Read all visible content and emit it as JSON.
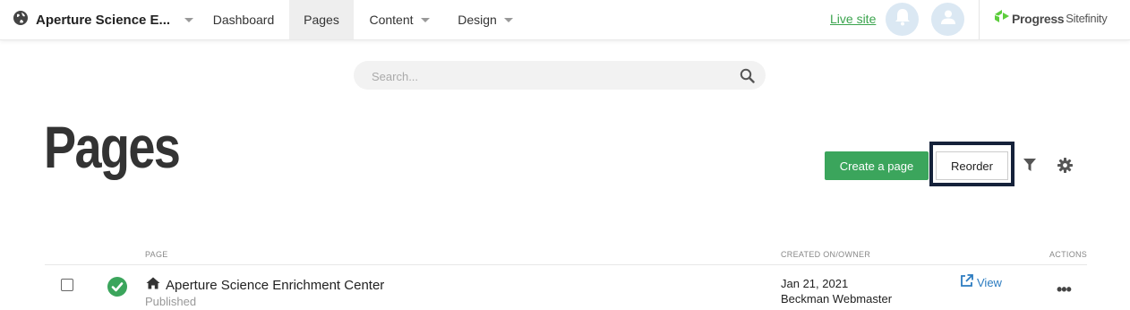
{
  "nav": {
    "site_name": "Aperture Science E...",
    "items": [
      {
        "label": "Dashboard"
      },
      {
        "label": "Pages"
      },
      {
        "label": "Content"
      },
      {
        "label": "Design"
      }
    ],
    "live_site": "Live site",
    "brand_left": "Progress",
    "brand_right": "Sitefinity"
  },
  "search": {
    "placeholder": "Search..."
  },
  "header": {
    "title": "Pages",
    "create_label": "Create a page",
    "reorder_label": "Reorder"
  },
  "table": {
    "columns": {
      "page": "PAGE",
      "created": "CREATED ON/OWNER",
      "actions": "ACTIONS"
    },
    "rows": [
      {
        "title": "Aperture Science Enrichment Center",
        "status": "Published",
        "date": "Jan 21, 2021",
        "owner": "Beckman Webmaster",
        "view": "View",
        "actions": "•••"
      }
    ]
  },
  "colors": {
    "accent_green": "#3ba55c",
    "link_blue": "#2b7bc0",
    "focus_outline": "#15223a"
  }
}
